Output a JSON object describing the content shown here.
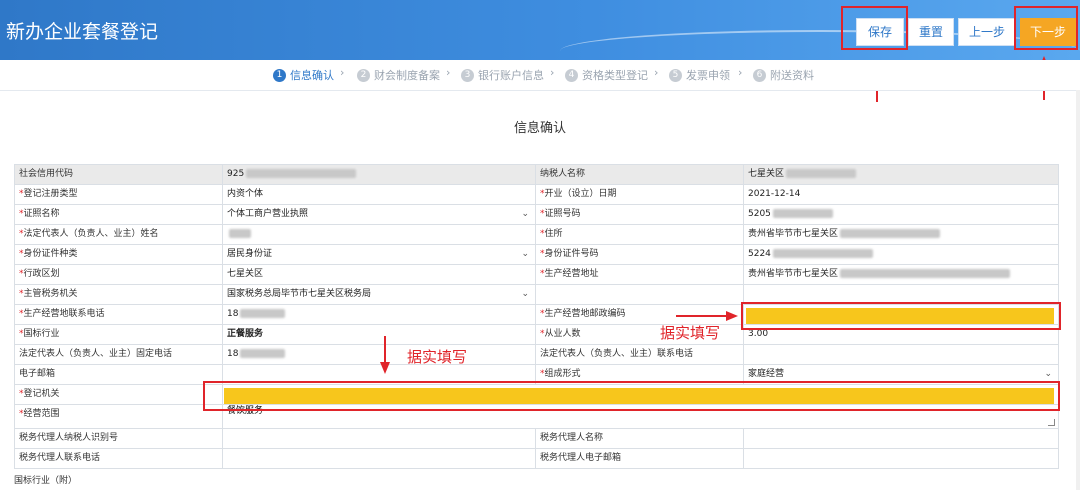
{
  "header": {
    "title": "新办企业套餐登记"
  },
  "toolbar": {
    "save": "保存",
    "reset": "重置",
    "prev": "上一步",
    "next": "下一步"
  },
  "steps": [
    {
      "num": "1",
      "label": "信息确认"
    },
    {
      "num": "2",
      "label": "财会制度备案"
    },
    {
      "num": "3",
      "label": "银行账户信息"
    },
    {
      "num": "4",
      "label": "资格类型登记"
    },
    {
      "num": "5",
      "label": "发票申领"
    },
    {
      "num": "6",
      "label": "附送资料"
    }
  ],
  "section_title": "信息确认",
  "annotations": {
    "fill_truthfully": "据实填写"
  },
  "form": {
    "credit_code": {
      "label": "社会信用代码",
      "value": "925"
    },
    "taxpayer_name": {
      "label": "纳税人名称",
      "value": "七星关区"
    },
    "reg_type": {
      "label": "登记注册类型",
      "value": "内资个体"
    },
    "open_date": {
      "label": "开业（设立）日期",
      "value": "2021-12-14"
    },
    "cert_name": {
      "label": "证照名称",
      "value": "个体工商户营业执照"
    },
    "cert_no": {
      "label": "证照号码",
      "value": "5205"
    },
    "legal_name": {
      "label": "法定代表人（负责人、业主）姓名",
      "value": ""
    },
    "address": {
      "label": "住所",
      "value": "贵州省毕节市七星关区"
    },
    "id_type": {
      "label": "身份证件种类",
      "value": "居民身份证"
    },
    "id_no": {
      "label": "身份证件号码",
      "value": "5224"
    },
    "admin_area": {
      "label": "行政区划",
      "value": "七星关区"
    },
    "biz_address": {
      "label": "生产经营地址",
      "value": "贵州省毕节市七星关区"
    },
    "tax_office": {
      "label": "主管税务机关",
      "value": "国家税务总局毕节市七星关区税务局"
    },
    "biz_phone": {
      "label": "生产经营地联系电话",
      "value": "18"
    },
    "biz_postcode": {
      "label": "生产经营地邮政编码",
      "value": ""
    },
    "industry": {
      "label": "国标行业",
      "value": "正餐服务"
    },
    "employees": {
      "label": "从业人数",
      "value": "3.00"
    },
    "legal_fixed_phone": {
      "label": "法定代表人（负责人、业主）固定电话",
      "value": "18"
    },
    "legal_contact_phone": {
      "label": "法定代表人（负责人、业主）联系电话",
      "value": ""
    },
    "email": {
      "label": "电子邮箱",
      "value": ""
    },
    "org_form": {
      "label": "组成形式",
      "value": "家庭经营"
    },
    "reg_authority": {
      "label": "登记机关",
      "value": ""
    },
    "biz_scope": {
      "label": "经营范围",
      "value": "餐饮服务"
    },
    "agent_id": {
      "label": "税务代理人纳税人识别号",
      "value": ""
    },
    "agent_name": {
      "label": "税务代理人名称",
      "value": ""
    },
    "agent_phone": {
      "label": "税务代理人联系电话",
      "value": ""
    },
    "agent_email": {
      "label": "税务代理人电子邮箱",
      "value": ""
    }
  },
  "bottom_label": "国标行业（附）",
  "colors": {
    "header_blue": "#2f78c8",
    "next_orange": "#f5a623",
    "highlight_yellow": "#f7c61c",
    "annotation_red": "#e0242a"
  }
}
